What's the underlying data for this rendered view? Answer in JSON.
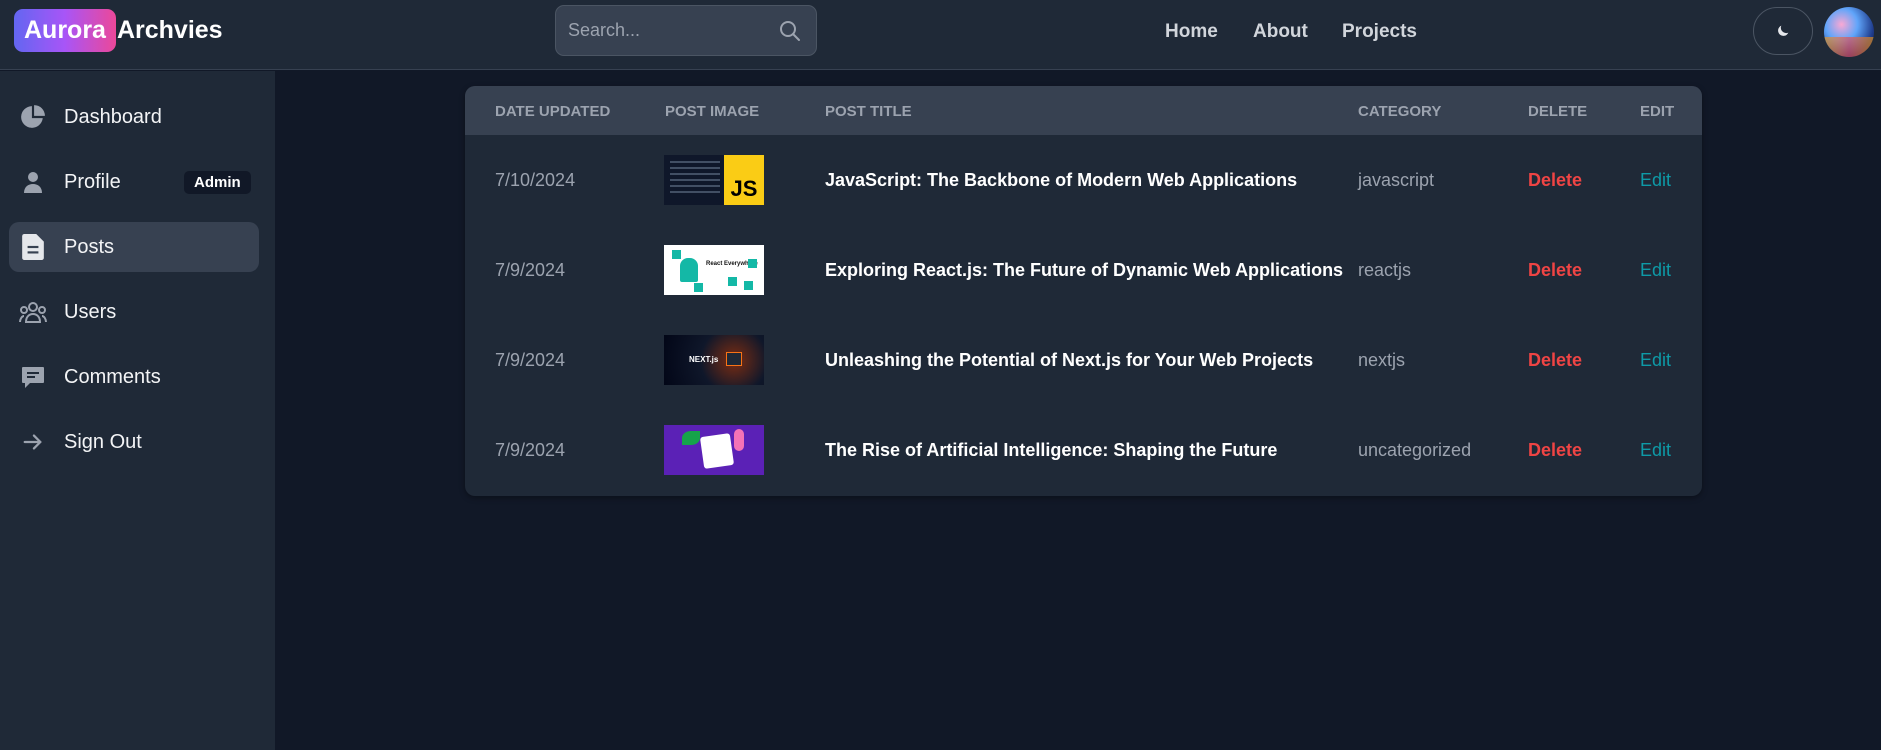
{
  "header": {
    "logo_badge": "Aurora",
    "logo_rest": "Archvies",
    "search_placeholder": "Search...",
    "nav": [
      "Home",
      "About",
      "Projects"
    ]
  },
  "sidebar": {
    "items": [
      {
        "label": "Dashboard",
        "icon": "pie-chart-icon"
      },
      {
        "label": "Profile",
        "icon": "user-icon",
        "badge": "Admin"
      },
      {
        "label": "Posts",
        "icon": "document-icon",
        "active": true
      },
      {
        "label": "Users",
        "icon": "users-icon"
      },
      {
        "label": "Comments",
        "icon": "comment-icon"
      },
      {
        "label": "Sign Out",
        "icon": "arrow-right-icon"
      }
    ]
  },
  "table": {
    "headers": [
      "Date Updated",
      "Post Image",
      "Post Title",
      "Category",
      "Delete",
      "Edit"
    ],
    "rows": [
      {
        "date": "7/10/2024",
        "image": "javascript-thumbnail",
        "title": "JavaScript: The Backbone of Modern Web Applications",
        "category": "javascript",
        "delete": "Delete",
        "edit": "Edit"
      },
      {
        "date": "7/9/2024",
        "image": "react-thumbnail",
        "title": "Exploring React.js: The Future of Dynamic Web Applications",
        "category": "reactjs",
        "delete": "Delete",
        "edit": "Edit"
      },
      {
        "date": "7/9/2024",
        "image": "nextjs-thumbnail",
        "title": "Unleashing the Potential of Next.js for Your Web Projects",
        "category": "nextjs",
        "delete": "Delete",
        "edit": "Edit"
      },
      {
        "date": "7/9/2024",
        "image": "ai-thumbnail",
        "title": "The Rise of Artificial Intelligence: Shaping the Future",
        "category": "uncategorized",
        "delete": "Delete",
        "edit": "Edit"
      }
    ]
  },
  "thumb_text": {
    "js": "JS",
    "react": "React Everywhere",
    "next": "NEXT.js"
  },
  "colors": {
    "accent_gradient": [
      "#6366f1",
      "#a855f7",
      "#ec4899"
    ],
    "delete": "#ef4444",
    "edit": "#0e9aa7"
  }
}
